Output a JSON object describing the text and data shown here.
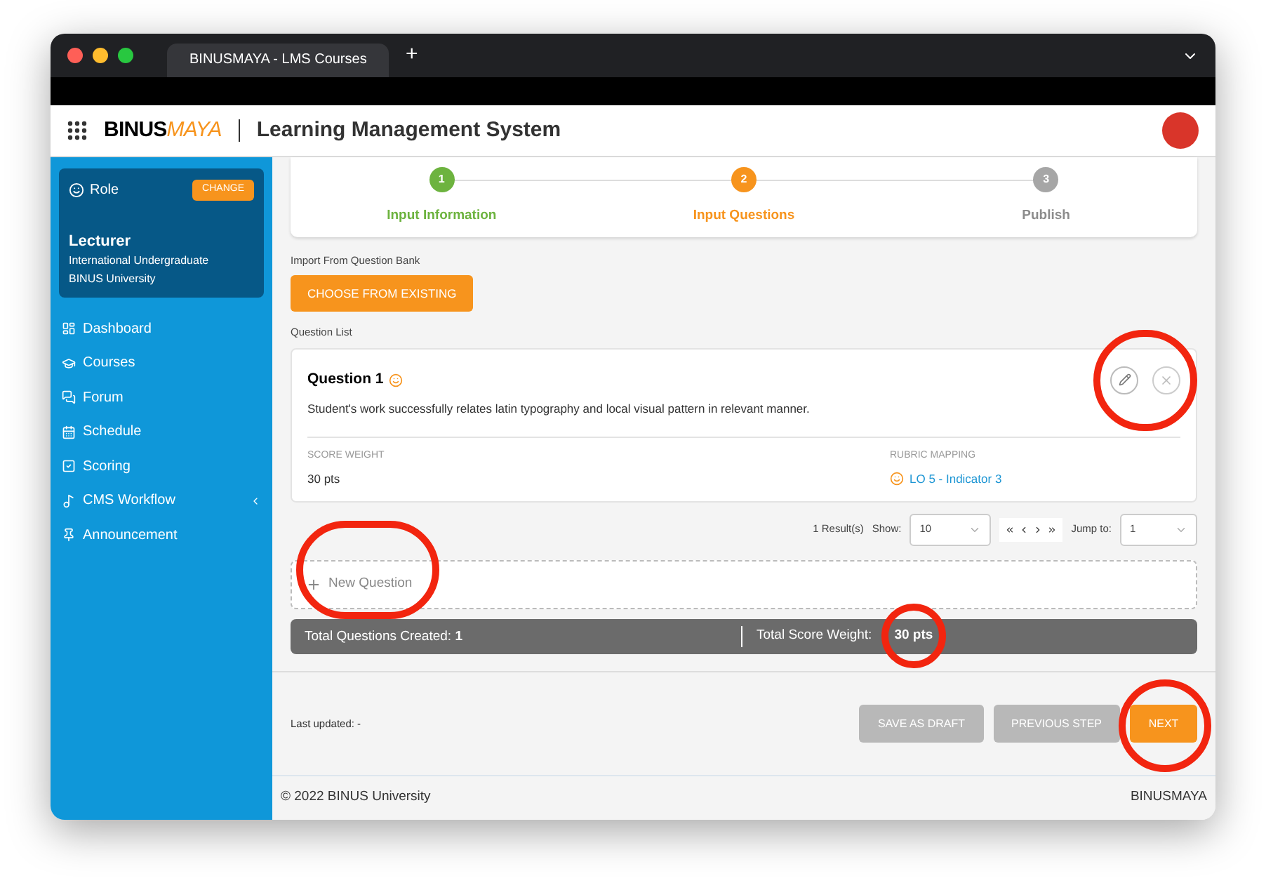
{
  "browser": {
    "tab_title": "BINUSMAYA - LMS Courses",
    "new_tab": "+"
  },
  "header": {
    "logo_bold": "BINUS",
    "logo_accent": "MAYA",
    "title": "Learning Management System"
  },
  "sidebar": {
    "role_label": "Role",
    "change_button": "CHANGE",
    "role": "Lecturer",
    "program": "International Undergraduate",
    "institution": "BINUS University",
    "items": [
      {
        "label": "Dashboard",
        "expandable": false
      },
      {
        "label": "Courses",
        "expandable": false
      },
      {
        "label": "Forum",
        "expandable": false
      },
      {
        "label": "Schedule",
        "expandable": false
      },
      {
        "label": "Scoring",
        "expandable": false
      },
      {
        "label": "CMS Workflow",
        "expandable": true
      },
      {
        "label": "Announcement",
        "expandable": false
      }
    ]
  },
  "stepper": [
    {
      "number": "1",
      "label": "Input Information",
      "completed": true,
      "selected": false
    },
    {
      "number": "2",
      "label": "Input Questions",
      "completed": false,
      "selected": true
    },
    {
      "number": "3",
      "label": "Publish",
      "completed": false,
      "selected": false
    }
  ],
  "import": {
    "label": "Import From Question Bank",
    "button": "CHOOSE FROM EXISTING"
  },
  "question_list": {
    "label": "Question List",
    "questions": [
      {
        "title": "Question 1",
        "text": "Student's work successfully relates latin typography and local visual pattern in relevant manner.",
        "score_label": "SCORE WEIGHT",
        "score": "30 pts",
        "rubric_label": "RUBRIC MAPPING",
        "rubric": "LO 5 - Indicator 3"
      }
    ]
  },
  "pagination": {
    "results": "1 Result(s)",
    "show_label": "Show:",
    "show_value": "10",
    "jump_label": "Jump to:",
    "jump_value": "1"
  },
  "new_question": "New Question",
  "totals": {
    "questions_label": "Total Questions Created:",
    "questions_value": "1",
    "score_label": "Total Score Weight:",
    "score_value": "30 pts"
  },
  "actions": {
    "last_updated": "Last updated: -",
    "save_draft": "SAVE AS DRAFT",
    "previous": "PREVIOUS STEP",
    "next": "NEXT"
  },
  "footer": {
    "copyright": "© 2022 BINUS University",
    "brand": "BINUSMAYA"
  }
}
